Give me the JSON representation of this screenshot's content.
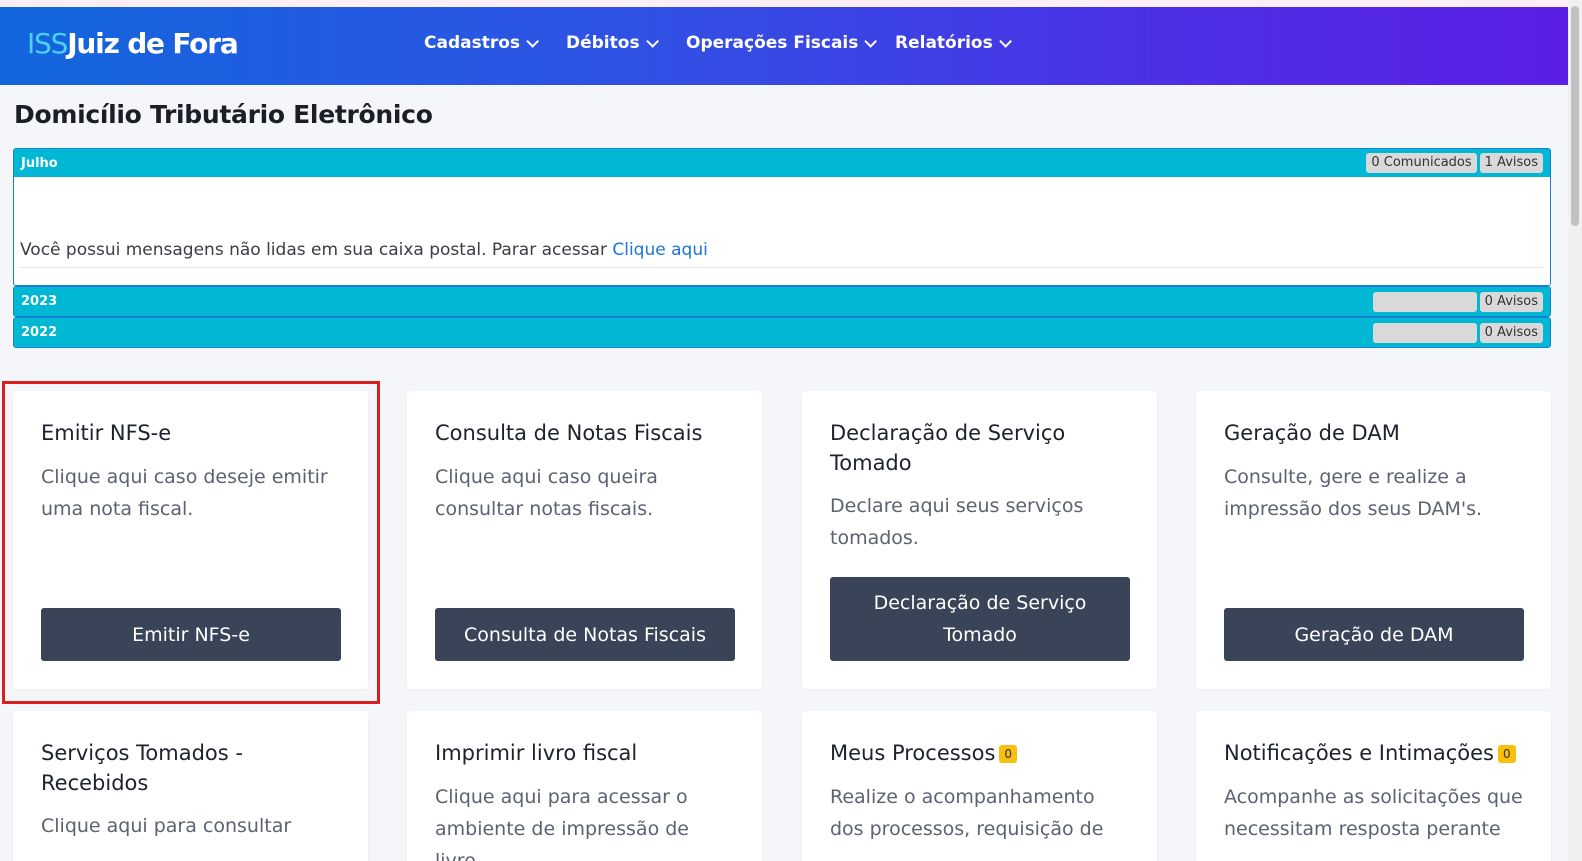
{
  "brand": {
    "prefix": "ISS",
    "name": "Juiz de Fora"
  },
  "nav": [
    {
      "label": "Cadastros"
    },
    {
      "label": "Débitos"
    },
    {
      "label": "Operações Fiscais"
    },
    {
      "label": "Relatórios"
    }
  ],
  "page_title": "Domicílio Tributário Eletrônico",
  "panels": [
    {
      "title": "Julho",
      "badge1": "0 Comunicados",
      "badge2": "1 Avisos",
      "message": "Você possui mensagens não lidas em sua caixa postal. Parar acessar ",
      "link": "Clique aqui"
    },
    {
      "title": "2023",
      "badge1": "",
      "badge2": "0 Avisos"
    },
    {
      "title": "2022",
      "badge1": "",
      "badge2": "0 Avisos"
    }
  ],
  "cards": [
    {
      "title": "Emitir NFS-e",
      "text": "Clique aqui caso deseje emitir uma nota fiscal.",
      "button": "Emitir NFS-e"
    },
    {
      "title": "Consulta de Notas Fiscais",
      "text": "Clique aqui caso queira consultar notas fiscais.",
      "button": "Consulta de Notas Fiscais"
    },
    {
      "title": "Declaração de Serviço Tomado",
      "text": "Declare aqui seus serviços tomados.",
      "button": "Declaração de Serviço Tomado"
    },
    {
      "title": "Geração de DAM",
      "text": "Consulte, gere e realize a impressão dos seus DAM's.",
      "button": "Geração de DAM"
    },
    {
      "title": "Serviços Tomados - Recebidos",
      "text": "Clique aqui para consultar"
    },
    {
      "title": "Imprimir livro fiscal",
      "text": "Clique aqui para acessar o ambiente de impressão de livro"
    },
    {
      "title": "Meus Processos",
      "count": "0",
      "text": "Realize o acompanhamento dos processos, requisição de"
    },
    {
      "title": "Notificações e Intimações",
      "count": "0",
      "text": "Acompanhe as solicitações que necessitam resposta perante"
    }
  ],
  "colors": {
    "accent_panel": "#00b8d4",
    "button": "#3a4459",
    "highlight": "#d9201f",
    "badge_count": "#f6c00c"
  }
}
